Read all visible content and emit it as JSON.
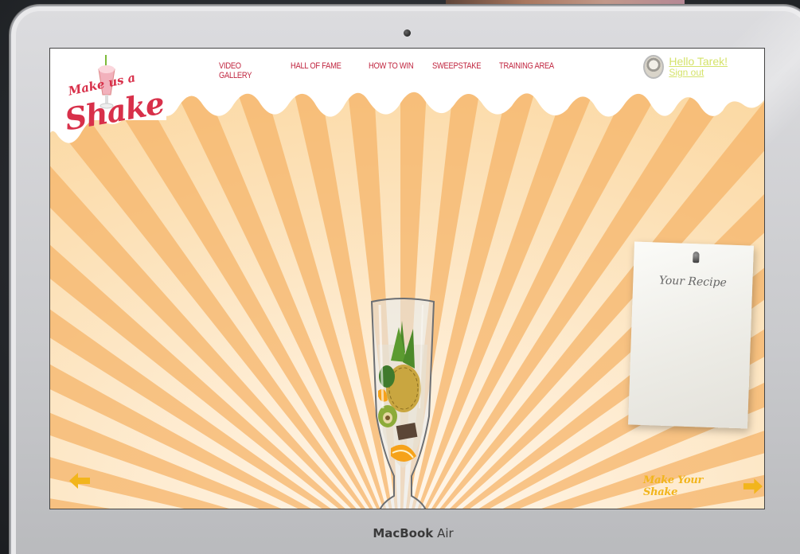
{
  "site": {
    "logo_small": "Make us a",
    "logo_big": "Shake"
  },
  "nav": {
    "items": [
      {
        "label": "VIDEO GALLERY"
      },
      {
        "label": "HALL OF FAME"
      },
      {
        "label": "HOW TO WIN"
      },
      {
        "label": "SWEEPSTAKE"
      },
      {
        "label": "TRAINING AREA"
      }
    ]
  },
  "user": {
    "greeting": "Hello Tarek!",
    "signout": "Sign out"
  },
  "recipe": {
    "title": "Your Recipe"
  },
  "footer_nav": {
    "next_label": "Make Your Shake"
  },
  "device": {
    "brand_bold": "MacBook",
    "brand_light": "Air"
  },
  "colors": {
    "accent_red": "#c0253f",
    "user_green": "#d5e36b",
    "arrow_yellow": "#f2b51c",
    "ray_orange": "#f6b56a"
  },
  "icons": {
    "prev": "arrow-left-icon",
    "next": "arrow-right-icon"
  }
}
